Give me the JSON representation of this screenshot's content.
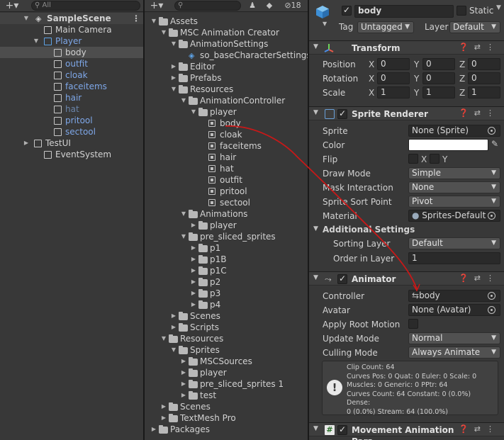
{
  "hierarchy": {
    "add_label": "+▾",
    "search_placeholder": "All",
    "scene_name": "SampleScene",
    "items": [
      {
        "label": "Main Camera",
        "style": "normal",
        "icon": "cube-icon"
      },
      {
        "label": "Player",
        "style": "blue",
        "icon": "prefab-cube-icon"
      },
      {
        "label": "body",
        "style": "sel",
        "icon": "cube-icon"
      },
      {
        "label": "outfit",
        "style": "blue",
        "icon": "cube-icon"
      },
      {
        "label": "cloak",
        "style": "blue",
        "icon": "cube-icon"
      },
      {
        "label": "faceitems",
        "style": "blue",
        "icon": "cube-icon"
      },
      {
        "label": "hair",
        "style": "blue",
        "icon": "cube-icon"
      },
      {
        "label": "hat",
        "style": "dim",
        "icon": "cube-icon"
      },
      {
        "label": "pritool",
        "style": "blue",
        "icon": "cube-icon"
      },
      {
        "label": "sectool",
        "style": "blue",
        "icon": "cube-icon"
      },
      {
        "label": "TestUI",
        "style": "normal",
        "icon": "cube-icon"
      },
      {
        "label": "EventSystem",
        "style": "normal",
        "icon": "cube-icon"
      }
    ]
  },
  "project": {
    "add_label": "+▾",
    "hidden_count": "18",
    "items": [
      {
        "label": "Assets",
        "icon": "folder-icon"
      },
      {
        "label": "MSC Animation Creator",
        "icon": "folder-icon"
      },
      {
        "label": "AnimationSettings",
        "icon": "folder-icon"
      },
      {
        "label": "so_baseCharacterSettings",
        "icon": "scriptable-object-icon"
      },
      {
        "label": "Editor",
        "icon": "folder-icon"
      },
      {
        "label": "Prefabs",
        "icon": "folder-icon"
      },
      {
        "label": "Resources",
        "icon": "folder-icon"
      },
      {
        "label": "AnimationController",
        "icon": "folder-icon"
      },
      {
        "label": "player",
        "icon": "folder-icon"
      },
      {
        "label": "body",
        "icon": "animator-controller-icon"
      },
      {
        "label": "cloak",
        "icon": "animator-controller-icon"
      },
      {
        "label": "faceitems",
        "icon": "animator-controller-icon"
      },
      {
        "label": "hair",
        "icon": "animator-controller-icon"
      },
      {
        "label": "hat",
        "icon": "animator-controller-icon"
      },
      {
        "label": "outfit",
        "icon": "animator-controller-icon"
      },
      {
        "label": "pritool",
        "icon": "animator-controller-icon"
      },
      {
        "label": "sectool",
        "icon": "animator-controller-icon"
      },
      {
        "label": "Animations",
        "icon": "folder-icon"
      },
      {
        "label": "player",
        "icon": "folder-icon"
      },
      {
        "label": "pre_sliced_sprites",
        "icon": "folder-icon"
      },
      {
        "label": "p1",
        "icon": "folder-icon"
      },
      {
        "label": "p1B",
        "icon": "folder-icon"
      },
      {
        "label": "p1C",
        "icon": "folder-icon"
      },
      {
        "label": "p2",
        "icon": "folder-icon"
      },
      {
        "label": "p3",
        "icon": "folder-icon"
      },
      {
        "label": "p4",
        "icon": "folder-icon"
      },
      {
        "label": "Scenes",
        "icon": "folder-icon"
      },
      {
        "label": "Scripts",
        "icon": "folder-icon"
      },
      {
        "label": "Resources",
        "icon": "folder-icon"
      },
      {
        "label": "Sprites",
        "icon": "folder-icon"
      },
      {
        "label": "MSCSources",
        "icon": "folder-icon"
      },
      {
        "label": "player",
        "icon": "folder-icon"
      },
      {
        "label": "pre_sliced_sprites 1",
        "icon": "folder-icon"
      },
      {
        "label": "test",
        "icon": "folder-icon"
      },
      {
        "label": "Scenes",
        "icon": "folder-icon"
      },
      {
        "label": "TextMesh Pro",
        "icon": "folder-icon"
      },
      {
        "label": "Packages",
        "icon": "folder-icon"
      }
    ]
  },
  "inspector": {
    "object_name": "body",
    "static_label": "Static",
    "tag_label": "Tag",
    "tag_value": "Untagged",
    "layer_label": "Layer",
    "layer_value": "Default",
    "transform": {
      "title": "Transform",
      "position_label": "Position",
      "rotation_label": "Rotation",
      "scale_label": "Scale",
      "axis_x": "X",
      "axis_y": "Y",
      "axis_z": "Z",
      "position": [
        "0",
        "0",
        "0"
      ],
      "rotation": [
        "0",
        "0",
        "0"
      ],
      "scale": [
        "1",
        "1",
        "1"
      ]
    },
    "sprite_renderer": {
      "title": "Sprite Renderer",
      "sprite_label": "Sprite",
      "sprite_value": "None (Sprite)",
      "color_label": "Color",
      "color_value": "#ffffff",
      "flip_label": "Flip",
      "flip_x": "X",
      "flip_y": "Y",
      "draw_mode_label": "Draw Mode",
      "draw_mode_value": "Simple",
      "mask_label": "Mask Interaction",
      "mask_value": "None",
      "sort_point_label": "Sprite Sort Point",
      "sort_point_value": "Pivot",
      "material_label": "Material",
      "material_value": "Sprites-Default",
      "additional_label": "Additional Settings",
      "sorting_layer_label": "Sorting Layer",
      "sorting_layer_value": "Default",
      "order_label": "Order in Layer",
      "order_value": "1"
    },
    "animator": {
      "title": "Animator",
      "controller_label": "Controller",
      "controller_value": "body",
      "avatar_label": "Avatar",
      "avatar_value": "None (Avatar)",
      "root_motion_label": "Apply Root Motion",
      "update_label": "Update Mode",
      "update_value": "Normal",
      "culling_label": "Culling Mode",
      "culling_value": "Always Animate",
      "info_text": "Clip Count: 64\nCurves Pos: 0 Quat: 0 Euler: 0 Scale: 0\nMuscles: 0 Generic: 0 PPtr: 64\nCurves Count: 64 Constant: 0 (0.0%) Dense:\n0 (0.0%) Stream: 64 (100.0%)"
    },
    "movement": {
      "title": "Movement Animation Para"
    }
  }
}
